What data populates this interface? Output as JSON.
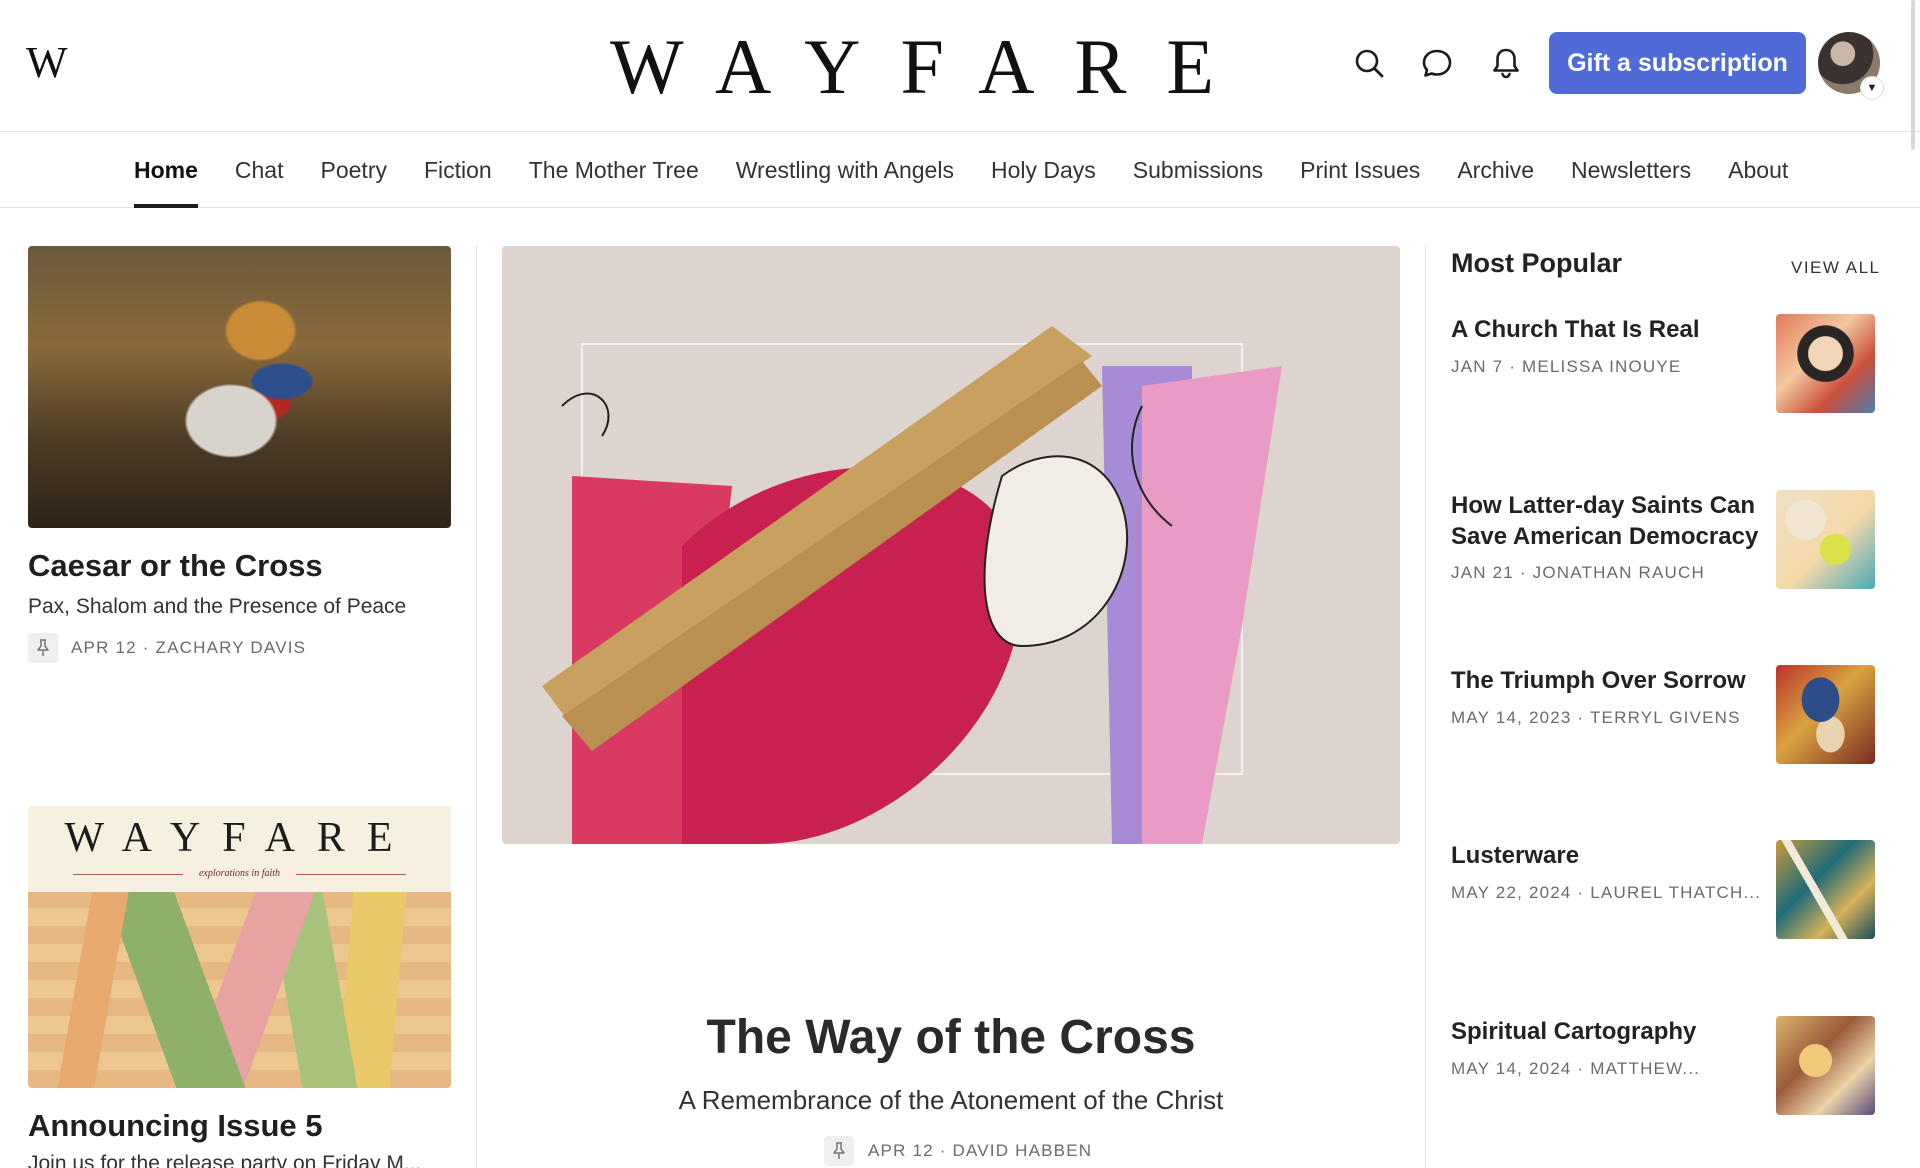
{
  "header": {
    "logo_mark": "W",
    "wordmark": "WAYFARE",
    "gift_button": "Gift a subscription"
  },
  "nav": {
    "items": [
      "Home",
      "Chat",
      "Poetry",
      "Fiction",
      "The Mother Tree",
      "Wrestling with Angels",
      "Holy Days",
      "Submissions",
      "Print Issues",
      "Archive",
      "Newsletters",
      "About"
    ],
    "active": "Home"
  },
  "left": {
    "post1": {
      "title": "Caesar or the Cross",
      "subtitle": "Pax, Shalom and the Presence of Peace",
      "meta": "APR 12 · ZACHARY DAVIS"
    },
    "cover": {
      "word": "WAYFARE",
      "tagline": "explorations in faith"
    },
    "post2": {
      "title": "Announcing Issue 5",
      "subtitle": "Join us for the release party on Friday M..."
    }
  },
  "feature": {
    "title": "The Way of the Cross",
    "subtitle": "A Remembrance of the Atonement of the Christ",
    "meta": "APR 12 · DAVID HABBEN"
  },
  "popular": {
    "heading": "Most Popular",
    "view_all": "VIEW ALL",
    "items": [
      {
        "title": "A Church That Is Real",
        "meta": "JAN 7 · MELISSA INOUYE"
      },
      {
        "title": "How Latter-day Saints Can Save American Democracy",
        "meta": "JAN 21 · JONATHAN RAUCH"
      },
      {
        "title": "The Triumph Over Sorrow",
        "meta": "MAY 14, 2023 · TERRYL GIVENS"
      },
      {
        "title": "Lusterware",
        "meta": "MAY 22, 2024 · LAUREL THATCH..."
      },
      {
        "title": "Spiritual Cartography",
        "meta": "MAY 14, 2024 · MATTHEW..."
      }
    ]
  },
  "colors": {
    "accent": "#4f6bd8",
    "text": "#1c1c1c",
    "meta": "#6b6b6b",
    "divider": "#e3e3e3"
  },
  "icons": [
    "search-icon",
    "chat-bubble-icon",
    "bell-icon",
    "pin-icon",
    "chevron-down-icon"
  ]
}
